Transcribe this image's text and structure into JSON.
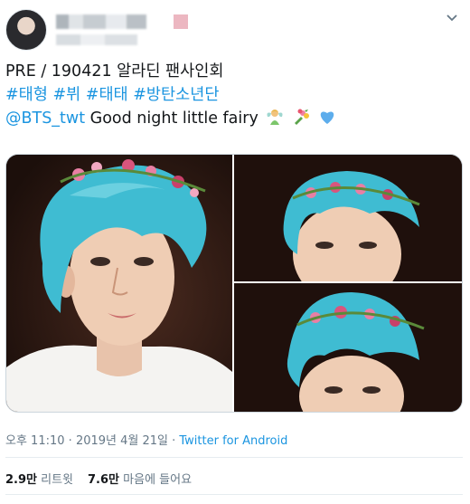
{
  "tweet": {
    "line1": "PRE / 190421 알라딘 팬사인회",
    "hashtags": [
      "#태형",
      "#뷔",
      "#태태",
      "#방탄소년단"
    ],
    "mention": "@BTS_twt",
    "message": " Good night little fairy",
    "emojis": [
      "fairy-emoji",
      "bouquet-emoji",
      "blue-heart-emoji"
    ]
  },
  "meta": {
    "time": "오후 11:10",
    "sep1": " · ",
    "date": "2019년 4월 21일",
    "sep2": " · ",
    "source": "Twitter for Android"
  },
  "stats": {
    "retweets_count": "2.9만",
    "retweets_label": " 리트윗",
    "likes_count": "7.6만",
    "likes_label": " 마음에 들어요"
  },
  "colors": {
    "link": "#1b95e0",
    "meta": "#657786",
    "hair": "#3fbcd2"
  },
  "icons": {
    "caret": "chevron-down-icon"
  }
}
